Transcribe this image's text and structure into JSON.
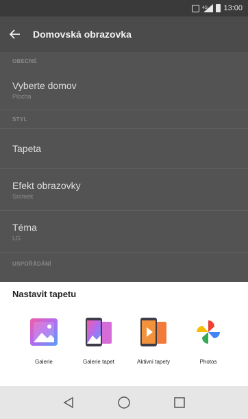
{
  "status_bar": {
    "time": "13:00",
    "icons": [
      "nfc-icon",
      "signal-icon",
      "battery-icon"
    ]
  },
  "toolbar": {
    "back_icon": "back-arrow-icon",
    "title": "Domovská obrazovka"
  },
  "settings": {
    "section_general": "OBECNÉ",
    "select_home": {
      "title": "Vyberte domov",
      "value": "Plocha"
    },
    "section_style": "STYL",
    "wallpaper": {
      "title": "Tapeta"
    },
    "screen_effect": {
      "title": "Efekt obrazovky",
      "value": "Snímek"
    },
    "theme": {
      "title": "Téma",
      "value": "LG"
    },
    "section_sort": "USPOŘÁDÁNÍ"
  },
  "sheet": {
    "title": "Nastavit tapetu",
    "apps": [
      {
        "label": "Galerie",
        "icon": "gallery-icon"
      },
      {
        "label": "Galerie tapet",
        "icon": "wallpaper-gallery-icon"
      },
      {
        "label": "Aktivní tapety",
        "icon": "live-wallpaper-icon"
      },
      {
        "label": "Photos",
        "icon": "google-photos-icon"
      }
    ]
  },
  "nav_bar": {
    "buttons": [
      "back-triangle-icon",
      "home-circle-icon",
      "recents-square-icon"
    ]
  },
  "colors": {
    "dim_background": "#535353",
    "toolbar": "#4b4b4b",
    "statusbar": "#3a3a3a",
    "sheet": "#ffffff",
    "navbar": "#e6e6e6"
  }
}
